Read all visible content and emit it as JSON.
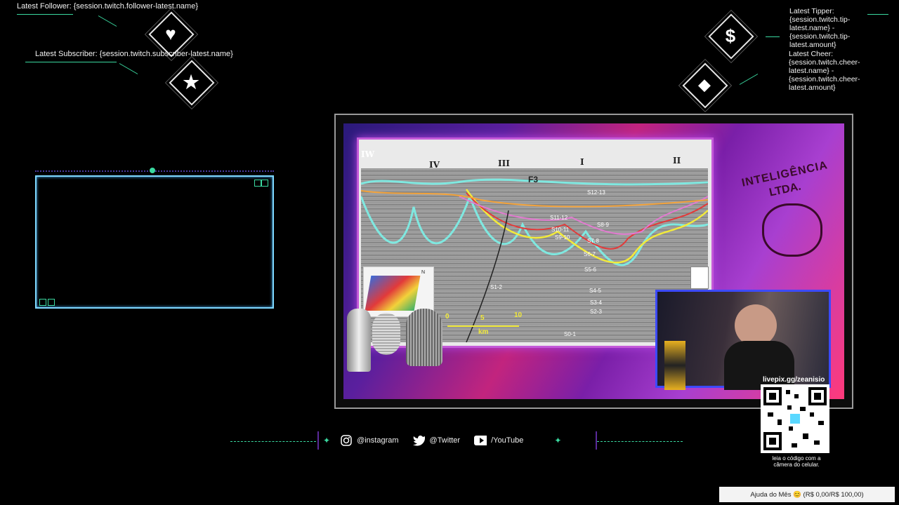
{
  "alerts": {
    "latest_follower": "Latest Follower: {session.twitch.follower-latest.name}",
    "latest_subscriber": "Latest Subscriber: {session.twitch.subscriber-latest.name}",
    "latest_tipper": "Latest Tipper: {session.twitch.tip-latest.name} - {session.twitch.tip-latest.amount}",
    "latest_cheer": "Latest Cheer: {session.twitch.cheer-latest.name} - {session.twitch.cheer-latest.amount}"
  },
  "icons": {
    "follower": "heart-icon",
    "subscriber": "star-icon",
    "tipper": "dollar-icon",
    "cheer": "diamond-gem-icon"
  },
  "slide": {
    "corner_label": "IW",
    "roman_labels": [
      "IV",
      "III",
      "I",
      "II"
    ],
    "fault_label": "F3",
    "layer_labels": [
      "S12-13",
      "S11-12",
      "S10-11",
      "S9-10",
      "S8-9",
      "S7-8",
      "S6-7",
      "S5-6",
      "S4-5",
      "S3-4",
      "S2-3",
      "S1-2",
      "S0-1"
    ],
    "scale_ticks": [
      "0",
      "5",
      "10"
    ],
    "scale_unit": "km",
    "inset_north": "N"
  },
  "brand": {
    "line1": "INTELIGÊNCIA",
    "line2": "LTDA."
  },
  "social": {
    "instagram": "@instagram",
    "twitter": "@Twitter",
    "youtube": "/YouTube"
  },
  "qr": {
    "url_label": "livepix.gg/zeanisio",
    "caption": "leia o código com a câmera do celular."
  },
  "goal": {
    "label": "Ajuda do Mês 😊 (R$ 0,00/R$ 100,00)"
  },
  "colors": {
    "accent": "#3ad9a0",
    "frame_blue": "#7fd8ff"
  }
}
